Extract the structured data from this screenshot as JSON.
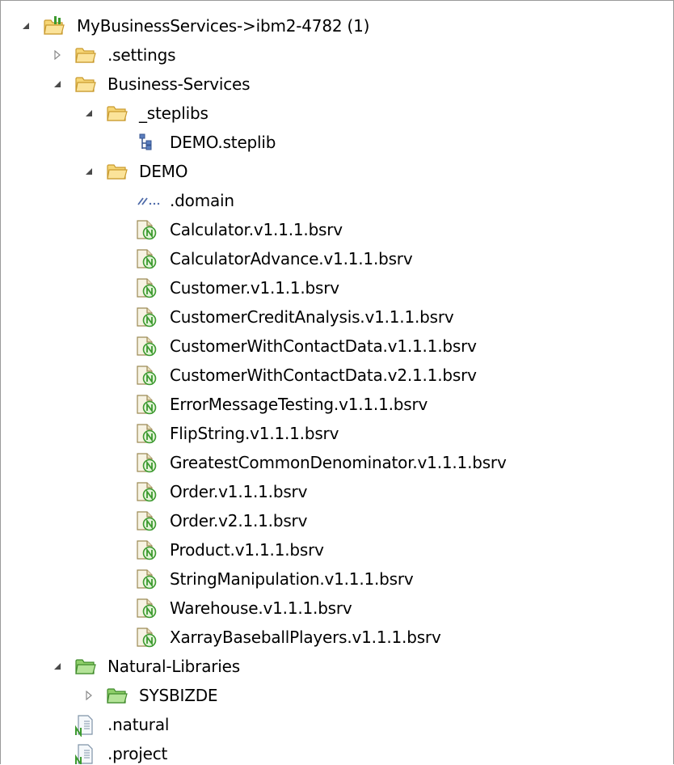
{
  "tree": {
    "root": {
      "label": "MyBusinessServices->ibm2-4782 (1)",
      "icon": "project-folder-icon",
      "expanded": true
    },
    "items": [
      {
        "label": ".settings",
        "icon": "folder-icon",
        "expanded": false
      },
      {
        "label": "Business-Services",
        "icon": "folder-icon",
        "expanded": true
      },
      {
        "label": "_steplibs",
        "icon": "folder-icon",
        "expanded": true
      },
      {
        "label": "DEMO.steplib",
        "icon": "steplib-icon"
      },
      {
        "label": "DEMO",
        "icon": "folder-icon",
        "expanded": true
      },
      {
        "label": ".domain",
        "icon": "domain-icon"
      },
      {
        "label": "Calculator.v1.1.1.bsrv",
        "icon": "business-service-icon"
      },
      {
        "label": "CalculatorAdvance.v1.1.1.bsrv",
        "icon": "business-service-icon"
      },
      {
        "label": "Customer.v1.1.1.bsrv",
        "icon": "business-service-icon"
      },
      {
        "label": "CustomerCreditAnalysis.v1.1.1.bsrv",
        "icon": "business-service-icon"
      },
      {
        "label": "CustomerWithContactData.v1.1.1.bsrv",
        "icon": "business-service-icon"
      },
      {
        "label": "CustomerWithContactData.v2.1.1.bsrv",
        "icon": "business-service-icon"
      },
      {
        "label": "ErrorMessageTesting.v1.1.1.bsrv",
        "icon": "business-service-icon"
      },
      {
        "label": "FlipString.v1.1.1.bsrv",
        "icon": "business-service-icon"
      },
      {
        "label": "GreatestCommonDenominator.v1.1.1.bsrv",
        "icon": "business-service-icon"
      },
      {
        "label": "Order.v1.1.1.bsrv",
        "icon": "business-service-icon"
      },
      {
        "label": "Order.v2.1.1.bsrv",
        "icon": "business-service-icon"
      },
      {
        "label": "Product.v1.1.1.bsrv",
        "icon": "business-service-icon"
      },
      {
        "label": "StringManipulation.v1.1.1.bsrv",
        "icon": "business-service-icon"
      },
      {
        "label": "Warehouse.v1.1.1.bsrv",
        "icon": "business-service-icon"
      },
      {
        "label": "XarrayBaseballPlayers.v1.1.1.bsrv",
        "icon": "business-service-icon"
      },
      {
        "label": "Natural-Libraries",
        "icon": "natural-library-folder-icon",
        "expanded": true
      },
      {
        "label": "SYSBIZDE",
        "icon": "natural-library-folder-icon",
        "expanded": false
      },
      {
        "label": ".natural",
        "icon": "natural-file-icon"
      },
      {
        "label": ".project",
        "icon": "natural-file-icon"
      }
    ]
  },
  "colors": {
    "folder_fill": "#f6d676",
    "folder_stroke": "#c99a2e",
    "library_fill": "#8fcf6a",
    "library_stroke": "#3f8a2a",
    "service_green": "#3c9a2f",
    "twisty_expanded": "#4a4a4a",
    "twisty_collapsed": "#8a8a8a"
  }
}
